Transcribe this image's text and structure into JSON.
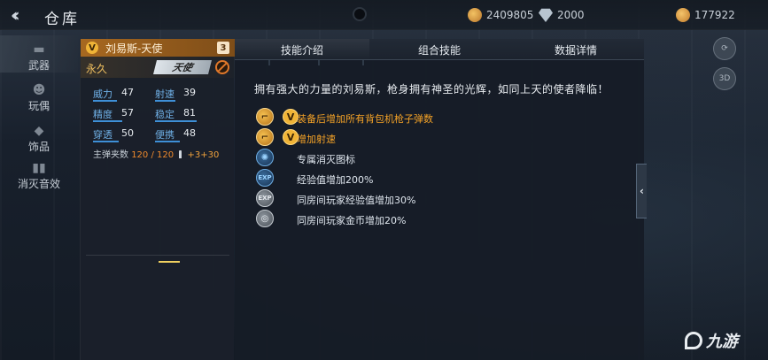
{
  "header": {
    "back_icon": "double-chevron-left-icon",
    "title": "仓库",
    "currencies": [
      {
        "icon": "coin-icon",
        "value": "2409805"
      },
      {
        "icon": "diamond-icon",
        "value": "2000"
      },
      {
        "icon": "gold-icon",
        "value": "177922"
      }
    ]
  },
  "nav": {
    "items": [
      {
        "label": "武器",
        "icon": "gun-icon",
        "active": true
      },
      {
        "label": "玩偶",
        "icon": "doll-icon",
        "active": false
      },
      {
        "label": "饰品",
        "icon": "accessory-icon",
        "active": false
      },
      {
        "label": "消灭音效",
        "icon": "sound-icon",
        "active": false
      }
    ]
  },
  "weapon": {
    "badge": "V",
    "name": "刘易斯-天使",
    "level": "3",
    "duration": "永久",
    "tag": "天使",
    "stats": [
      {
        "label": "威力",
        "value": "47",
        "fill": 0.47
      },
      {
        "label": "射速",
        "value": "39",
        "fill": 0.39
      },
      {
        "label": "精度",
        "value": "57",
        "fill": 0.57
      },
      {
        "label": "稳定",
        "value": "81",
        "fill": 0.81
      },
      {
        "label": "穿透",
        "value": "50",
        "fill": 0.5
      },
      {
        "label": "便携",
        "value": "48",
        "fill": 0.48
      }
    ],
    "ammo": {
      "label": "主弹夹数",
      "value": "120 / 120",
      "bonus1": "+3",
      "bonus2": "+30"
    }
  },
  "panel": {
    "tabs": [
      {
        "label": "技能介绍",
        "active": true
      },
      {
        "label": "组合技能",
        "active": false
      },
      {
        "label": "数据详情",
        "active": false
      }
    ],
    "description": "拥有强大的力量的刘易斯，枪身拥有神圣的光辉，如同上天的使者降临！",
    "skills": [
      {
        "icon": "ammo-gun-icon",
        "style": "gold",
        "vip": "V",
        "text": "装备后增加所有背包机枪子弹数",
        "color": "orange"
      },
      {
        "icon": "speed-gun-icon",
        "style": "gold",
        "vip": "V",
        "text": "增加射速",
        "color": "orange"
      },
      {
        "icon": "kill-icon",
        "style": "blue",
        "vip": "",
        "text": "专属消灭图标",
        "color": "white"
      },
      {
        "icon": "exp-icon",
        "style": "blue",
        "vip": "",
        "text": "经验值增加200%",
        "color": "white"
      },
      {
        "icon": "room-exp-icon",
        "style": "grey",
        "vip": "",
        "text": "同房间玩家经验值增加30%",
        "color": "white"
      },
      {
        "icon": "room-gold-icon",
        "style": "grey",
        "vip": "",
        "text": "同房间玩家金币增加20%",
        "color": "white"
      }
    ]
  },
  "side": {
    "expand_icon": "chevron-left-icon",
    "btn_3d": "3D"
  },
  "watermark": "九游"
}
